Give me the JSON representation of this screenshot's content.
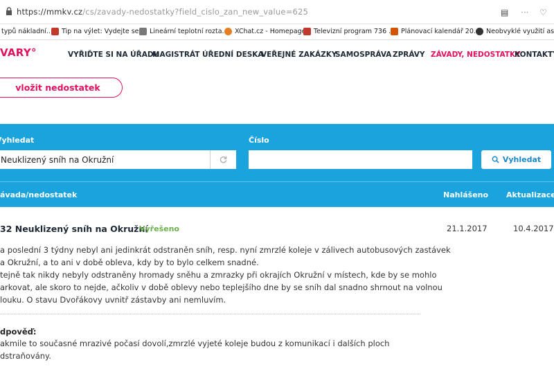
{
  "browser": {
    "url_host": "https://mmkv.cz",
    "url_path": "/cs/zavady-nedostatky?field_cislo_zan_new_value=625",
    "bookmarks": [
      {
        "label": "typů nákladní...",
        "color": "#888888"
      },
      {
        "label": "Tip na výlet: Vydejte se...",
        "color": "#c0392b"
      },
      {
        "label": "Lineární teplotní rozta...",
        "color": "#555555"
      },
      {
        "label": "XChat.cz - Homepage",
        "color": "#e67e22"
      },
      {
        "label": "Televizní program 736 ...",
        "color": "#c0392b"
      },
      {
        "label": "Plánovací kalendář 20...",
        "color": "#d35400"
      },
      {
        "label": "Neobvyklé využití aspi...",
        "color": "#333333"
      }
    ]
  },
  "site": {
    "logo": "VARY°",
    "brand_color": "#e2115f",
    "nav": [
      {
        "label": "VYŘIĎTE SI NA ÚŘADU",
        "active": false
      },
      {
        "label": "MAGISTRÁT",
        "active": false
      },
      {
        "label": "ÚŘEDNÍ DESKA",
        "active": false
      },
      {
        "label": "VEŘEJNÉ ZAKÁZKY",
        "active": false
      },
      {
        "label": "SAMOSPRÁVA",
        "active": false
      },
      {
        "label": "ZPRÁVY",
        "active": false
      },
      {
        "label": "ZÁVADY, NEDOSTATKY",
        "active": true
      },
      {
        "label": "KONTAKTY",
        "active": false
      }
    ],
    "report_button": "vložit nedostatek"
  },
  "search": {
    "band_color": "#1aa3dd",
    "query_label": "Vyhledat",
    "query_value": "Neuklizený sníh na Okružní",
    "number_label": "Číslo",
    "number_value": "",
    "button_label": "Vyhledat"
  },
  "table": {
    "col_issue": "Závada/nedostatek",
    "col_reported": "Nahlášeno",
    "col_updated": "Aktualizace"
  },
  "item": {
    "title": "32 Neuklizený sníh na Okružní",
    "status": "Vyřešeno",
    "reported": "21.1.2017",
    "updated": "10.4.2017",
    "description_lines": [
      "a poslední 3 týdny nebyl ani jedinkrát odstraněn sníh, resp. nyní zmrzlé koleje v zálivech autobusových zastávek",
      "a Okružní, a to ani v době obleva, kdy by to bylo celkem snadné.",
      "tejně tak nikdy nebyly odstraněny hromady sněhu a zmrazky při okrajích Okružní v místech, kde by se mohlo",
      "arkovat, ale skoro to nejde, ačkoliv v době oblevy nebo teplejšího dne by se sníh dal snadno shrnout na volnou",
      "louku. O stavu Dvořákovy uvnitř zástavby ani nemluvím."
    ],
    "response_label": "dpověď:",
    "response_lines": [
      "akmile to současné mrazivé počasí dovolí,zmrzlé vyjeté koleje budou z komunikací i dalších ploch",
      "dstraňovány."
    ]
  }
}
